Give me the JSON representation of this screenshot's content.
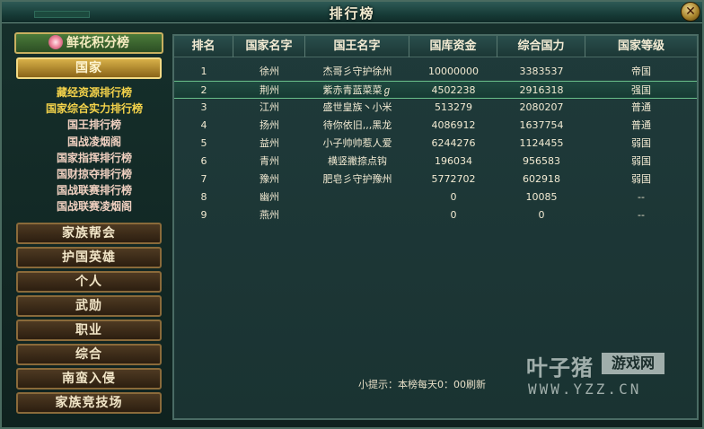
{
  "window": {
    "title": "排行榜",
    "close_symbol": "✕"
  },
  "sidebar": {
    "flower_button": "鲜花积分榜",
    "categories": [
      {
        "label": "国家",
        "active": true
      },
      {
        "label": "家族帮会"
      },
      {
        "label": "护国英雄"
      },
      {
        "label": "个人"
      },
      {
        "label": "武勋"
      },
      {
        "label": "职业"
      },
      {
        "label": "综合"
      },
      {
        "label": "南蛮入侵"
      },
      {
        "label": "家族竞技场"
      }
    ],
    "sub_items": [
      "藏经资源排行榜",
      "国家综合实力排行榜",
      "国王排行榜",
      "国战凌烟阁",
      "国家指挥排行榜",
      "国财掠夺排行榜",
      "国战联赛排行榜",
      "国战联赛凌烟阁"
    ]
  },
  "table": {
    "headers": [
      "排名",
      "国家名字",
      "国王名字",
      "国库资金",
      "综合国力",
      "国家等级"
    ],
    "rows": [
      [
        "1",
        "徐州",
        "杰哥彡守护徐州",
        "10000000",
        "3383537",
        "帝国"
      ],
      [
        "2",
        "荆州",
        "紫赤青蓝菜菜ℊ",
        "4502238",
        "2916318",
        "强国"
      ],
      [
        "3",
        "江州",
        "盛世皇族丶小米",
        "513279",
        "2080207",
        "普通"
      ],
      [
        "4",
        "扬州",
        "待你依旧,,,黑龙",
        "4086912",
        "1637754",
        "普通"
      ],
      [
        "5",
        "益州",
        "小子帅帅惹人爱",
        "6244276",
        "1124455",
        "弱国"
      ],
      [
        "6",
        "青州",
        "横竖撇捺点钩",
        "196034",
        "956583",
        "弱国"
      ],
      [
        "7",
        "豫州",
        "肥皂彡守护豫州",
        "5772702",
        "602918",
        "弱国"
      ],
      [
        "8",
        "幽州",
        "",
        "0",
        "10085",
        "--"
      ],
      [
        "9",
        "燕州",
        "",
        "0",
        "0",
        "--"
      ]
    ],
    "selected_row": 1
  },
  "tip": "小提示：本榜每天0：00刷新",
  "watermark": {
    "main": "叶子猪",
    "box": "游戏网",
    "url": "WWW.YZZ.CN"
  },
  "colors": {
    "accent_gold": "#f3d24a",
    "selected_row_border": "#6ac08a"
  }
}
